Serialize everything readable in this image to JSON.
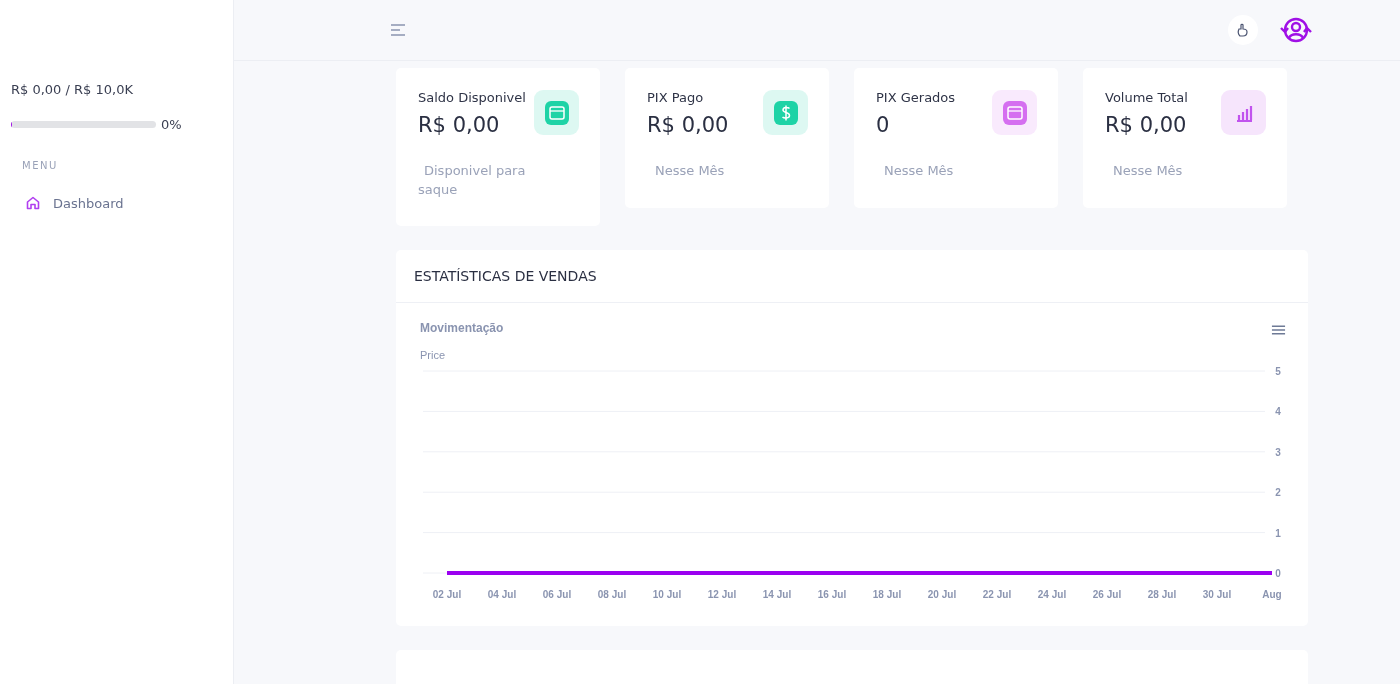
{
  "sidebar": {
    "balance": "R$ 0,00 / R$ 10,0K",
    "progress": {
      "level": 0,
      "reading": "0%"
    },
    "menu_heading": "MENU",
    "items": [
      {
        "label": "Dashboard",
        "selected": true
      }
    ]
  },
  "stats": [
    {
      "title": "Saldo Disponivel",
      "value": "R$ 0,00",
      "note": "Disponivel para saque",
      "kind": "wallet",
      "color": "#1ed3a6"
    },
    {
      "title": "PIX Pago",
      "value": "R$ 0,00",
      "note": "Nesse Mês",
      "kind": "dollar",
      "color": "#1ed3a6"
    },
    {
      "title": "PIX Gerados",
      "value": "0",
      "note": "Nesse Mês",
      "kind": "wallet",
      "color": "#d56ff0"
    },
    {
      "title": "Volume Total",
      "value": "R$ 0,00",
      "note": "Nesse Mês",
      "kind": "chart",
      "color": "#c153ee"
    }
  ],
  "sales_panel": {
    "title": "ESTATÍSTICAS DE VENDAS",
    "chart_data": {
      "type": "line",
      "title": "Movimentação",
      "ylabel": "Price",
      "categories": [
        "02 Jul",
        "04 Jul",
        "06 Jul",
        "08 Jul",
        "10 Jul",
        "12 Jul",
        "14 Jul",
        "16 Jul",
        "18 Jul",
        "20 Jul",
        "22 Jul",
        "24 Jul",
        "26 Jul",
        "28 Jul",
        "30 Jul",
        "Aug"
      ],
      "series": [
        {
          "color": "#9b00f0",
          "values": [
            0,
            0,
            0,
            0,
            0,
            0,
            0,
            0,
            0,
            0,
            0,
            0,
            0,
            0,
            0,
            0
          ]
        }
      ],
      "grid": true,
      "ylim": [
        0,
        5
      ],
      "yticks": [
        0,
        1,
        2,
        3,
        4,
        5
      ]
    }
  }
}
